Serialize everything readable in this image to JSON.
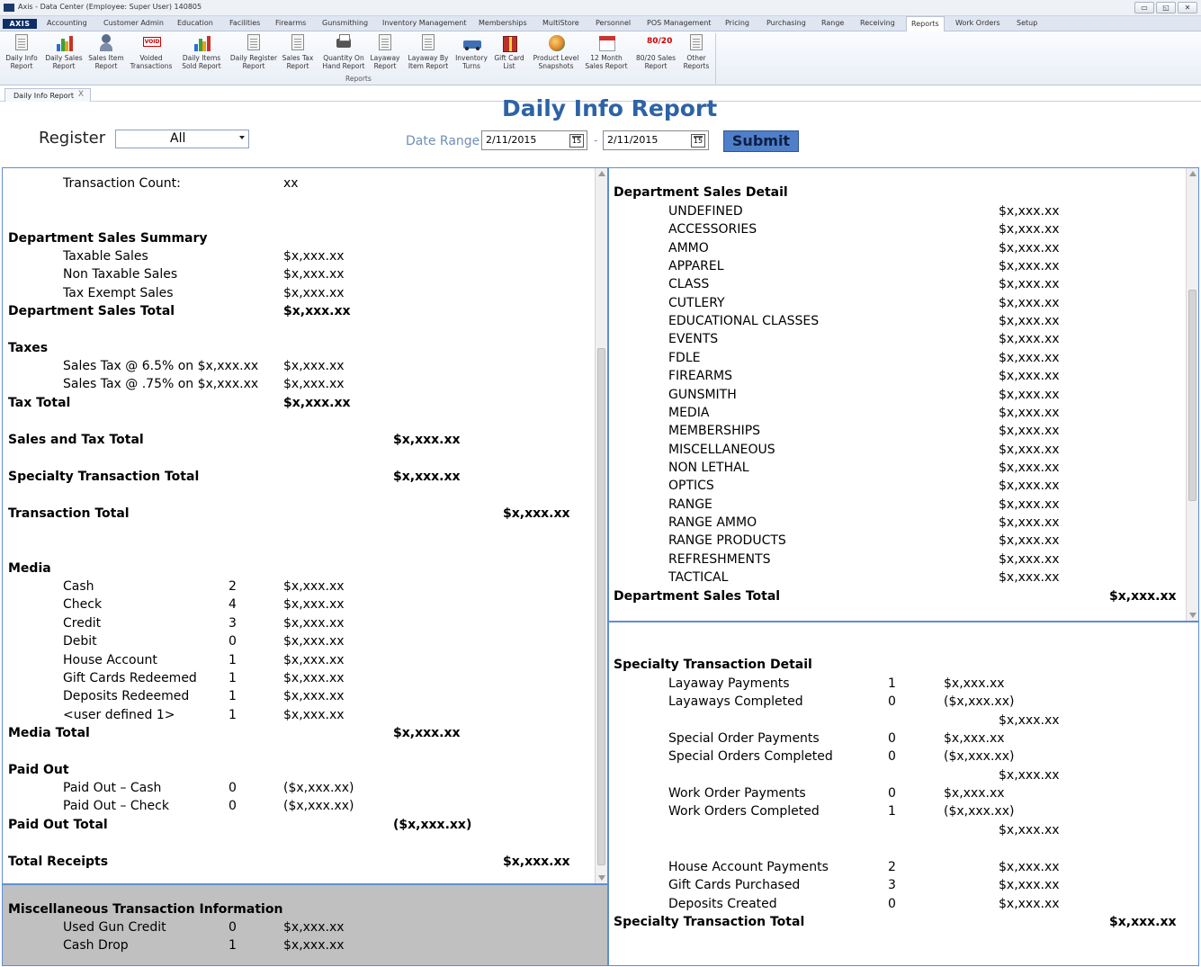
{
  "window": {
    "title": "Axis - Data Center (Employee: Super User) 140805",
    "btn_min": "▭",
    "btn_restore": "◱",
    "btn_close": "✕"
  },
  "menu": {
    "logo": "AXIS",
    "items": [
      "Accounting",
      "Customer Admin",
      "Education",
      "Facilities",
      "Firearms",
      "Gunsmithing",
      "Inventory Management",
      "Memberships",
      "MultiStore",
      "Personnel",
      "POS Management",
      "Pricing",
      "Purchasing",
      "Range",
      "Receiving",
      "Reports",
      "Work Orders",
      "Setup"
    ],
    "active": "Reports"
  },
  "ribbon": {
    "group_label": "Reports",
    "buttons": [
      {
        "label": "Daily Info\nReport",
        "icon": "document-icon"
      },
      {
        "label": "Daily Sales\nReport",
        "icon": "bar-chart-icon"
      },
      {
        "label": "Sales Item\nReport",
        "icon": "person-icon"
      },
      {
        "label": "Voided\nTransactions",
        "icon": "void-icon",
        "icon_text": "VOID"
      },
      {
        "label": "Daily Items\nSold Report",
        "icon": "bar-chart-icon"
      },
      {
        "label": "Daily Register\nReport",
        "icon": "document-icon"
      },
      {
        "label": "Sales Tax\nReport",
        "icon": "document-icon"
      },
      {
        "label": "Quantity On\nHand Report",
        "icon": "printer-icon"
      },
      {
        "label": "Layaway\nReport",
        "icon": "document-icon"
      },
      {
        "label": "Layaway By\nItem Report",
        "icon": "document-icon"
      },
      {
        "label": "Inventory\nTurns",
        "icon": "truck-icon"
      },
      {
        "label": "Gift Card\nList",
        "icon": "gift-card-icon"
      },
      {
        "label": "Product Level\nSnapshots",
        "icon": "globe-icon"
      },
      {
        "label": "12 Month\nSales Report",
        "icon": "calendar-icon"
      },
      {
        "label": "80/20 Sales\nReport",
        "icon": "eighty-twenty-icon",
        "icon_text": "80/20"
      },
      {
        "label": "Other\nReports",
        "icon": "document-icon"
      }
    ]
  },
  "doctab": {
    "label": "Daily Info Report",
    "close": "X"
  },
  "header": {
    "title": "Daily Info Report",
    "register_label": "Register",
    "register_value": "All",
    "date_range_label": "Date Range:",
    "date_from": "2/11/2015",
    "date_to": "2/11/2015",
    "date_sep": "-",
    "calendar_glyph": "15",
    "submit": "Submit"
  },
  "left": {
    "transaction_count_label": "Transaction Count:",
    "transaction_count_value": "xx",
    "dept_summary_heading": "Department Sales Summary",
    "dept_summary": [
      {
        "label": "Taxable Sales",
        "value": "$x,xxx.xx"
      },
      {
        "label": "Non Taxable Sales",
        "value": "$x,xxx.xx"
      },
      {
        "label": "Tax Exempt Sales",
        "value": "$x,xxx.xx"
      }
    ],
    "dept_total_label": "Department Sales Total",
    "dept_total_value": "$x,xxx.xx",
    "taxes_heading": "Taxes",
    "taxes": [
      {
        "label": "Sales Tax @ 6.5% on $x,xxx.xx",
        "value": "$x,xxx.xx"
      },
      {
        "label": "Sales Tax @ .75% on $x,xxx.xx",
        "value": "$x,xxx.xx"
      }
    ],
    "tax_total_label": "Tax Total",
    "tax_total_value": "$x,xxx.xx",
    "sales_tax_total_label": "Sales and Tax Total",
    "sales_tax_total_value": "$x,xxx.xx",
    "specialty_total_label": "Specialty Transaction Total",
    "specialty_total_value": "$x,xxx.xx",
    "transaction_total_label": "Transaction Total",
    "transaction_total_value": "$x,xxx.xx",
    "media_heading": "Media",
    "media": [
      {
        "label": "Cash",
        "count": "2",
        "value": "$x,xxx.xx"
      },
      {
        "label": "Check",
        "count": "4",
        "value": "$x,xxx.xx"
      },
      {
        "label": "Credit",
        "count": "3",
        "value": "$x,xxx.xx"
      },
      {
        "label": "Debit",
        "count": "0",
        "value": "$x,xxx.xx"
      },
      {
        "label": "House Account",
        "count": "1",
        "value": "$x,xxx.xx"
      },
      {
        "label": "Gift Cards Redeemed",
        "count": "1",
        "value": "$x,xxx.xx"
      },
      {
        "label": "Deposits Redeemed",
        "count": "1",
        "value": "$x,xxx.xx"
      },
      {
        "label": "<user defined 1>",
        "count": "1",
        "value": "$x,xxx.xx"
      }
    ],
    "media_total_label": "Media Total",
    "media_total_value": "$x,xxx.xx",
    "paidout_heading": "Paid Out",
    "paidout": [
      {
        "label": "Paid Out – Cash",
        "count": "0",
        "value": "($x,xxx.xx)"
      },
      {
        "label": "Paid Out – Check",
        "count": "0",
        "value": "($x,xxx.xx)"
      }
    ],
    "paidout_total_label": "Paid Out Total",
    "paidout_total_value": "($x,xxx.xx)",
    "total_receipts_label": "Total Receipts",
    "total_receipts_value": "$x,xxx.xx"
  },
  "misc": {
    "heading": "Miscellaneous Transaction Information",
    "rows": [
      {
        "label": "Used Gun Credit",
        "count": "0",
        "value": "$x,xxx.xx"
      },
      {
        "label": "Cash Drop",
        "count": "1",
        "value": "$x,xxx.xx"
      }
    ]
  },
  "dept_detail": {
    "heading": "Department Sales Detail",
    "rows": [
      {
        "label": "UNDEFINED",
        "value": "$x,xxx.xx"
      },
      {
        "label": "ACCESSORIES",
        "value": "$x,xxx.xx"
      },
      {
        "label": "AMMO",
        "value": "$x,xxx.xx"
      },
      {
        "label": "APPAREL",
        "value": "$x,xxx.xx"
      },
      {
        "label": "CLASS",
        "value": "$x,xxx.xx"
      },
      {
        "label": "CUTLERY",
        "value": "$x,xxx.xx"
      },
      {
        "label": "EDUCATIONAL CLASSES",
        "value": "$x,xxx.xx"
      },
      {
        "label": "EVENTS",
        "value": "$x,xxx.xx"
      },
      {
        "label": "FDLE",
        "value": "$x,xxx.xx"
      },
      {
        "label": "FIREARMS",
        "value": "$x,xxx.xx"
      },
      {
        "label": "GUNSMITH",
        "value": "$x,xxx.xx"
      },
      {
        "label": "MEDIA",
        "value": "$x,xxx.xx"
      },
      {
        "label": "MEMBERSHIPS",
        "value": "$x,xxx.xx"
      },
      {
        "label": "MISCELLANEOUS",
        "value": "$x,xxx.xx"
      },
      {
        "label": "NON LETHAL",
        "value": "$x,xxx.xx"
      },
      {
        "label": "OPTICS",
        "value": "$x,xxx.xx"
      },
      {
        "label": "RANGE",
        "value": "$x,xxx.xx"
      },
      {
        "label": "RANGE AMMO",
        "value": "$x,xxx.xx"
      },
      {
        "label": "RANGE PRODUCTS",
        "value": "$x,xxx.xx"
      },
      {
        "label": "REFRESHMENTS",
        "value": "$x,xxx.xx"
      },
      {
        "label": "TACTICAL",
        "value": "$x,xxx.xx"
      }
    ],
    "total_label": "Department Sales Total",
    "total_value": "$x,xxx.xx"
  },
  "specialty_detail": {
    "heading": "Specialty Transaction Detail",
    "rows": [
      {
        "label": "Layaway Payments",
        "count": "1",
        "value": "$x,xxx.xx"
      },
      {
        "label": "Layaways Completed",
        "count": "0",
        "value": "($x,xxx.xx)"
      },
      {
        "subtotal": "$x,xxx.xx"
      },
      {
        "label": "Special Order Payments",
        "count": "0",
        "value": "$x,xxx.xx"
      },
      {
        "label": "Special Orders Completed",
        "count": "0",
        "value": "($x,xxx.xx)"
      },
      {
        "subtotal": "$x,xxx.xx"
      },
      {
        "label": "Work Order Payments",
        "count": "0",
        "value": "$x,xxx.xx"
      },
      {
        "label": "Work Orders Completed",
        "count": "1",
        "value": "($x,xxx.xx)"
      },
      {
        "subtotal": "$x,xxx.xx"
      },
      {
        "label": "House Account Payments",
        "count": "2",
        "value": "$x,xxx.xx",
        "right": true
      },
      {
        "label": "Gift Cards Purchased",
        "count": "3",
        "value": "$x,xxx.xx",
        "right": true
      },
      {
        "label": "Deposits Created",
        "count": "0",
        "value": "$x,xxx.xx",
        "right": true
      }
    ],
    "total_label": "Specialty Transaction Total",
    "total_value": "$x,xxx.xx"
  }
}
